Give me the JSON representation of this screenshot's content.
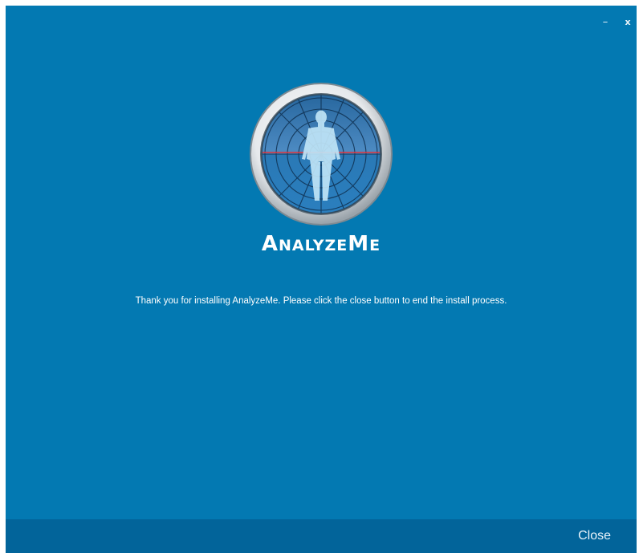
{
  "window": {
    "minimize_label": "–",
    "close_label": "x",
    "background": "#0379b2",
    "footer_background": "#02649a"
  },
  "logo": {
    "icon": "radar-body-icon",
    "brand_cap1": "A",
    "brand_rest1": "NALYZE",
    "brand_cap2": "M",
    "brand_rest2": "E"
  },
  "main": {
    "message": "Thank you for installing AnalyzeMe. Please click the close button to end the install process."
  },
  "footer": {
    "close_label": "Close"
  }
}
